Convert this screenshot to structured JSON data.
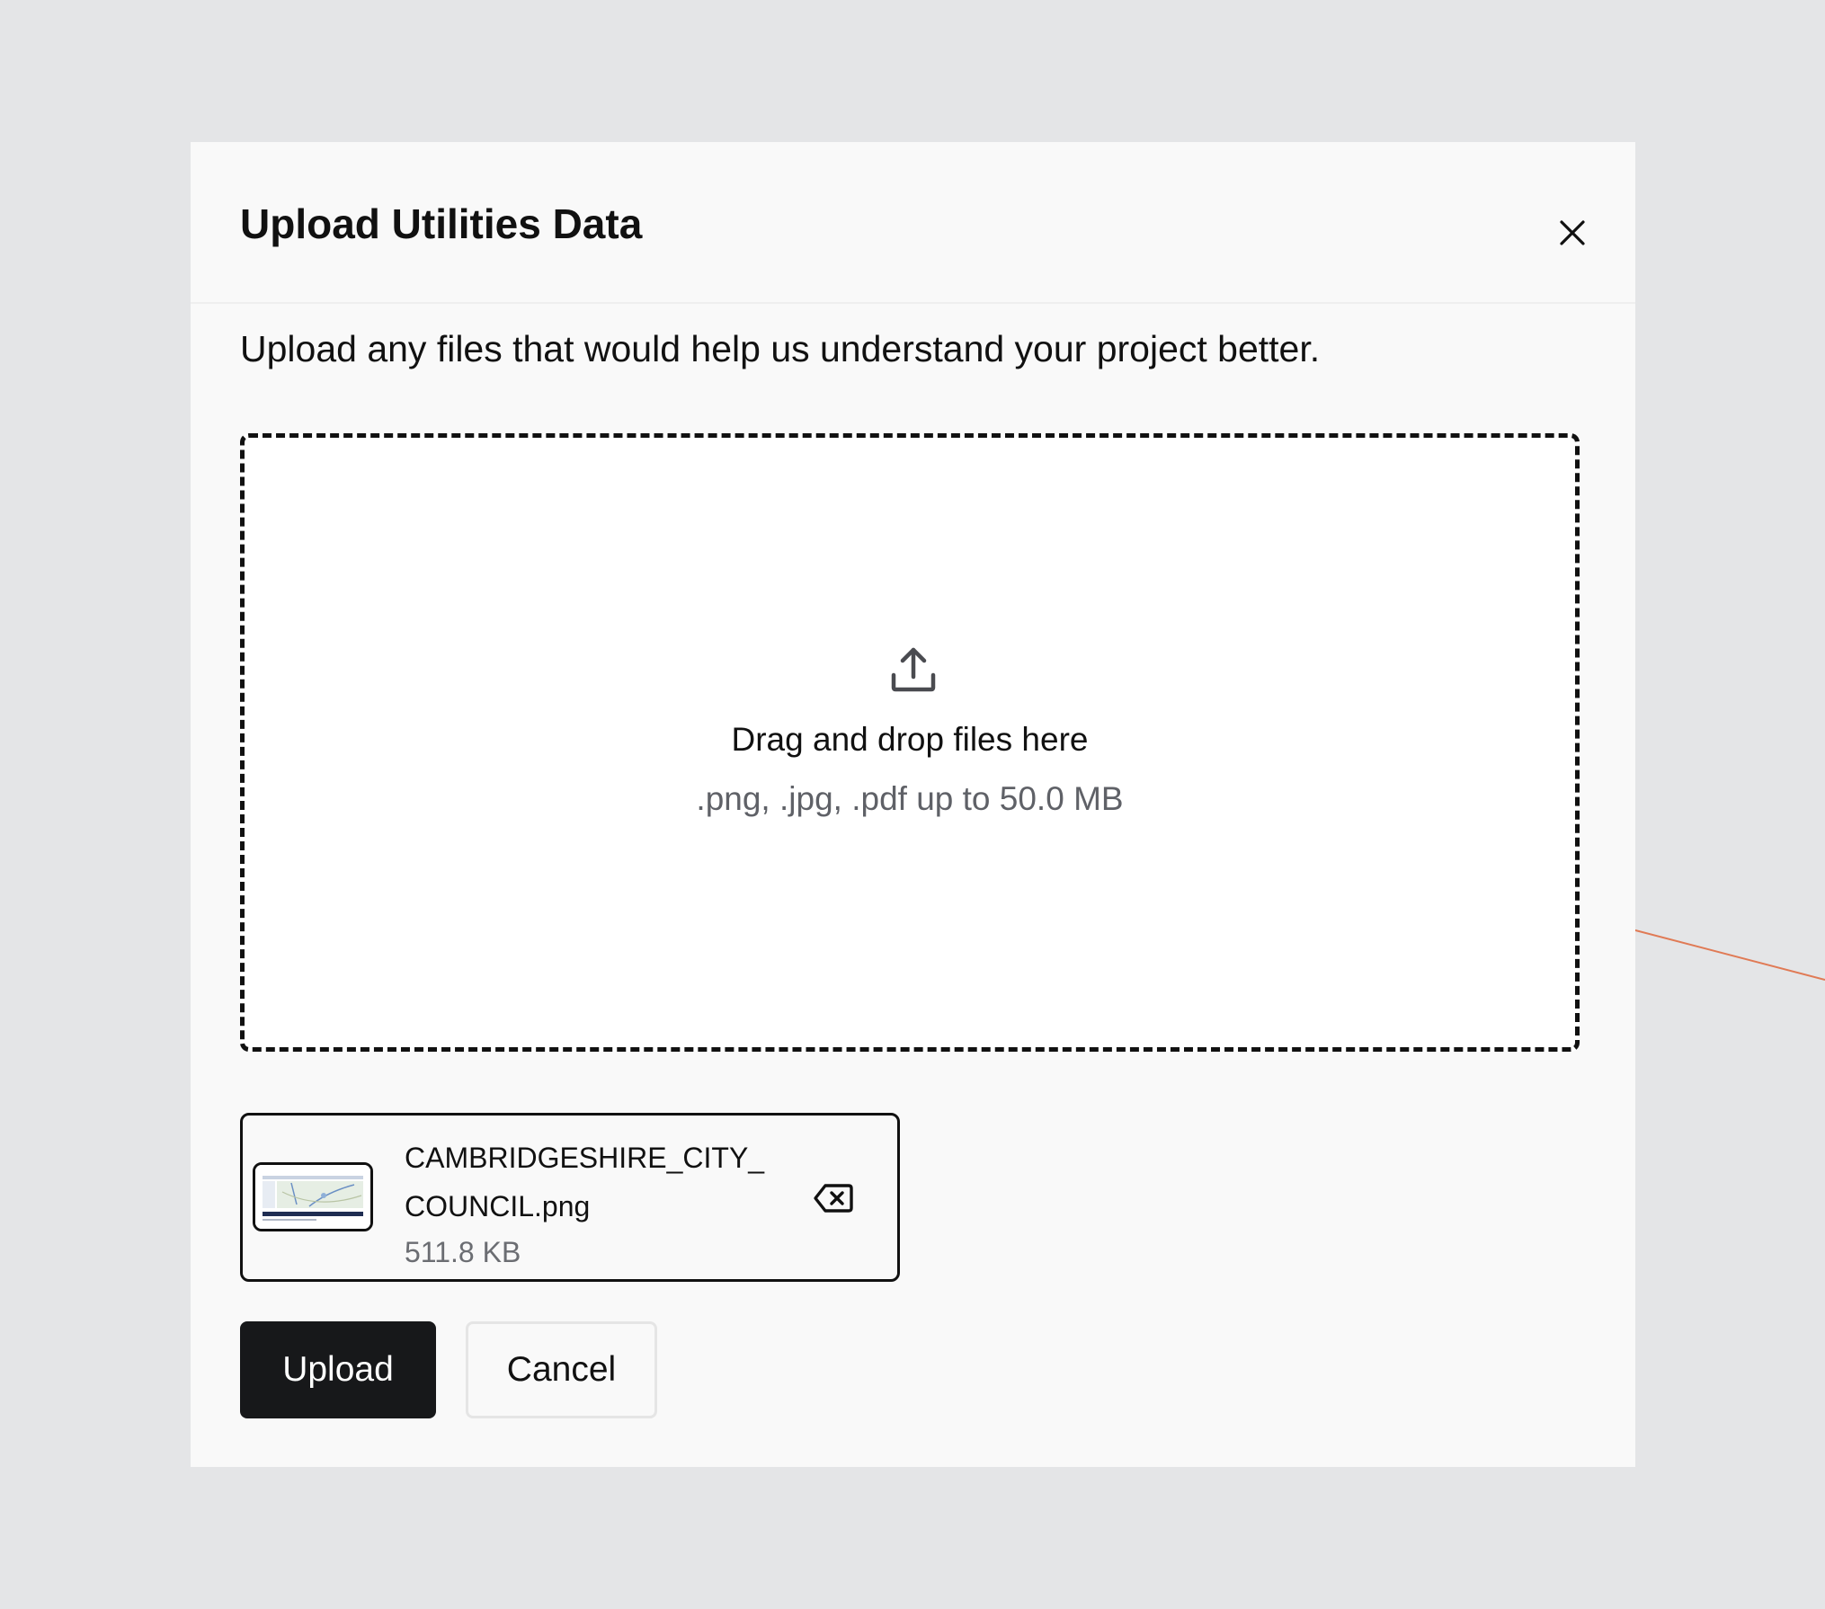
{
  "modal": {
    "title": "Upload Utilities Data",
    "description": "Upload any files that would help us understand your project better."
  },
  "dropzone": {
    "title": "Drag and drop files here",
    "hint": ".png, .jpg, .pdf up to 50.0 MB",
    "icon": "upload-icon"
  },
  "files": [
    {
      "name": "CAMBRIDGESHIRE_CITY_COUNCIL.png",
      "size": "511.8 KB",
      "thumbnail": "map-thumbnail",
      "remove_icon": "backspace-x-icon"
    }
  ],
  "actions": {
    "upload_label": "Upload",
    "cancel_label": "Cancel"
  },
  "colors": {
    "backdrop": "#e4e5e7",
    "modal_bg": "#f9f9f9",
    "primary": "#17181a",
    "text": "#111111",
    "muted": "#5f6167",
    "decor_line": "#e07a55"
  },
  "icons": {
    "close": "close-icon"
  }
}
